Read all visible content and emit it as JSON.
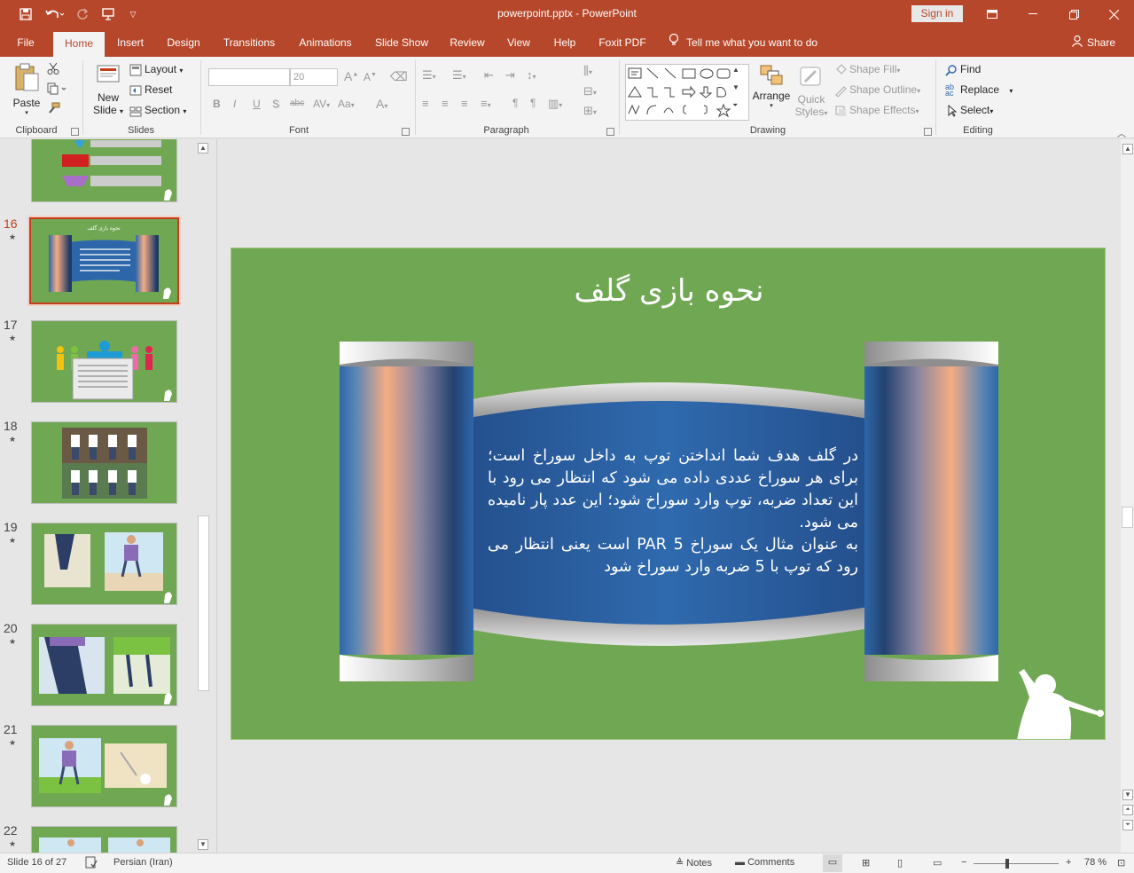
{
  "window": {
    "title": "powerpoint.pptx  -  PowerPoint",
    "sign_in": "Sign in"
  },
  "tabs": [
    "File",
    "Home",
    "Insert",
    "Design",
    "Transitions",
    "Animations",
    "Slide Show",
    "Review",
    "View",
    "Help",
    "Foxit PDF"
  ],
  "tell_me": "Tell me what you want to do",
  "share": "Share",
  "ribbon": {
    "clipboard": {
      "label": "Clipboard",
      "paste": "Paste"
    },
    "slides": {
      "label": "Slides",
      "new_slide_1": "New",
      "new_slide_2": "Slide",
      "layout": "Layout",
      "reset": "Reset",
      "section": "Section"
    },
    "font": {
      "label": "Font",
      "font_name": "",
      "font_size": "20",
      "bold": "B",
      "italic": "I",
      "underline": "U",
      "shadow": "S",
      "strike": "abc",
      "case": "Aa"
    },
    "paragraph": {
      "label": "Paragraph"
    },
    "drawing": {
      "label": "Drawing",
      "arrange": "Arrange",
      "quick_styles_1": "Quick",
      "quick_styles_2": "Styles",
      "shape_fill": "Shape Fill",
      "shape_outline": "Shape Outline",
      "shape_effects": "Shape Effects"
    },
    "editing": {
      "label": "Editing",
      "find": "Find",
      "replace": "Replace",
      "select": "Select"
    }
  },
  "thumbnails": [
    {
      "number": "16",
      "active": true
    },
    {
      "number": "17",
      "active": false
    },
    {
      "number": "18",
      "active": false
    },
    {
      "number": "19",
      "active": false
    },
    {
      "number": "20",
      "active": false
    },
    {
      "number": "21",
      "active": false
    },
    {
      "number": "22",
      "active": false
    }
  ],
  "slide": {
    "title": "نحوه بازی گلف",
    "body_1": "در گلف هدف شما انداختن توپ به داخل سوراخ است؛ برای هر سوراخ عددی داده می شود که انتظار می رود با این تعداد ضربه، توپ وارد سوراخ شود؛ این عدد پار نامیده می شود.",
    "body_2": "به عنوان مثال یک سوراخ  PAR 5 است یعنی انتظار می رود که توپ با 5 ضربه وارد سوراخ شود"
  },
  "status": {
    "slide_info": "Slide 16 of 27",
    "language": "Persian (Iran)",
    "notes": "Notes",
    "comments": "Comments",
    "zoom": "78 %"
  },
  "colors": {
    "accent": "#b7472a",
    "slide_green": "#70a752",
    "scroll_blue": "#2e67a9"
  }
}
